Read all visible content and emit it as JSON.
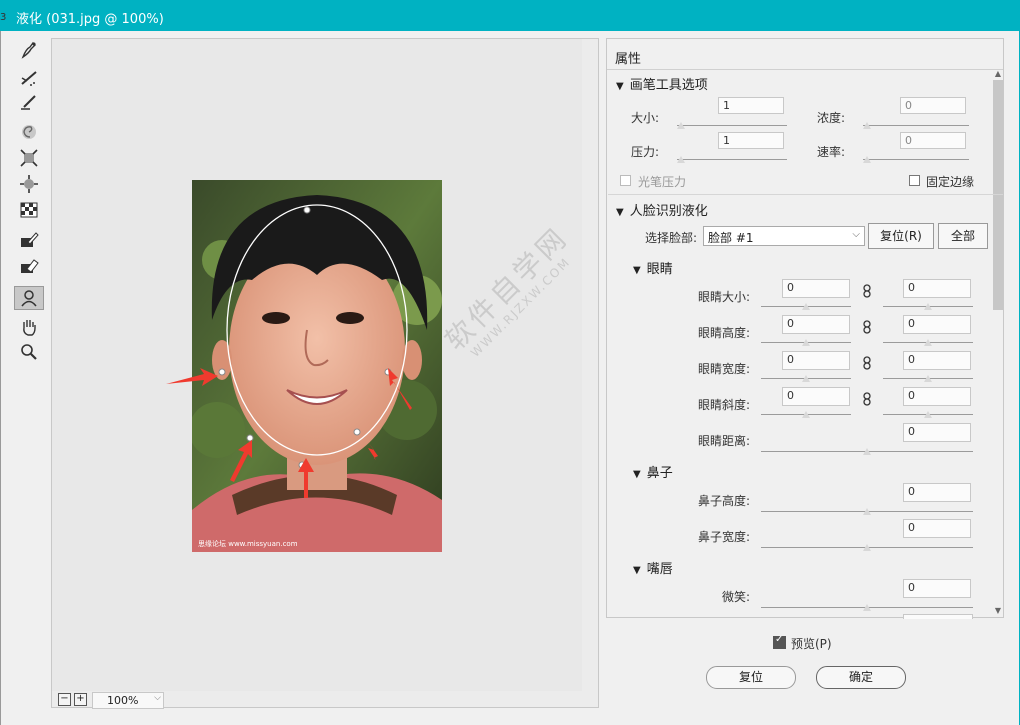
{
  "window": {
    "title": "液化 (031.jpg @ 100%)",
    "edge_fragment": "3"
  },
  "toolbar": {
    "tools": [
      {
        "name": "forward-warp-icon"
      },
      {
        "name": "reconstruct-icon"
      },
      {
        "name": "smooth-icon"
      },
      {
        "name": "twirl-icon"
      },
      {
        "name": "pucker-icon"
      },
      {
        "name": "bloat-icon"
      },
      {
        "name": "push-left-icon"
      },
      {
        "name": "freeze-mask-icon"
      },
      {
        "name": "thaw-mask-icon"
      },
      {
        "name": "face-tool-icon"
      },
      {
        "name": "hand-icon"
      },
      {
        "name": "zoom-icon"
      }
    ]
  },
  "canvas": {
    "watermark_text": "软件自学网",
    "watermark_url": "WWW.RJZXW.COM",
    "photo_caption": "思缘论坛 www.missyuan.com"
  },
  "zoom": {
    "minus": "−",
    "plus": "+",
    "value": "100%"
  },
  "panel": {
    "title": "属性",
    "brush_section": {
      "heading": "画笔工具选项",
      "size_label": "大小:",
      "size_value": "1",
      "density_label": "浓度:",
      "density_value": "0",
      "pressure_label": "压力:",
      "pressure_value": "1",
      "rate_label": "速率:",
      "rate_value": "0",
      "stylus_label": "光笔压力",
      "pin_edges_label": "固定边缘"
    },
    "face_section": {
      "heading": "人脸识别液化",
      "select_face_label": "选择脸部:",
      "select_face_value": "脸部 #1",
      "reset_label": "复位(R)",
      "all_label": "全部",
      "eyes": {
        "heading": "眼睛",
        "rows": [
          {
            "label": "眼睛大小:",
            "left": "0",
            "right": "0"
          },
          {
            "label": "眼睛高度:",
            "left": "0",
            "right": "0"
          },
          {
            "label": "眼睛宽度:",
            "left": "0",
            "right": "0"
          },
          {
            "label": "眼睛斜度:",
            "left": "0",
            "right": "0"
          }
        ],
        "distance_label": "眼睛距离:",
        "distance_value": "0"
      },
      "nose": {
        "heading": "鼻子",
        "height_label": "鼻子高度:",
        "height_value": "0",
        "width_label": "鼻子宽度:",
        "width_value": "0"
      },
      "mouth": {
        "heading": "嘴唇",
        "smile_label": "微笑:",
        "smile_value": "0"
      }
    }
  },
  "footer": {
    "preview_label": "预览(P)",
    "reset_label": "复位",
    "ok_label": "确定"
  },
  "colors": {
    "titlebar": "#00b2c2",
    "arrow": "#f03a2e"
  }
}
